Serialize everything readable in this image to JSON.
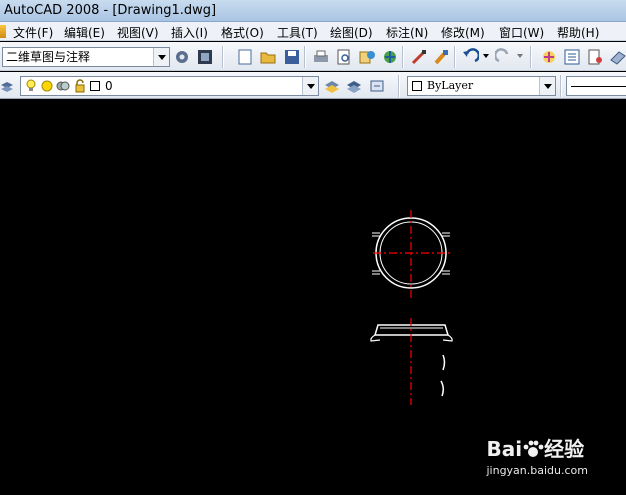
{
  "window": {
    "title": "AutoCAD 2008 - [Drawing1.dwg]"
  },
  "menu": {
    "items": [
      "文件(F)",
      "编辑(E)",
      "视图(V)",
      "插入(I)",
      "格式(O)",
      "工具(T)",
      "绘图(D)",
      "标注(N)",
      "修改(M)",
      "窗口(W)",
      "帮助(H)"
    ]
  },
  "toolbar": {
    "workspace_value": "二维草图与注释",
    "layer_value": "0",
    "color_value": "ByLayer"
  },
  "icons": {
    "app": "autocad-app-icon",
    "workspace_settings": "gear-icon",
    "my_workspace": "workspace-icon",
    "new": "new-file-icon",
    "open": "open-folder-icon",
    "save": "save-icon",
    "print": "print-icon",
    "preview": "print-preview-icon",
    "publish": "publish-icon",
    "3d_dwf": "3d-dwf-icon",
    "match": "match-properties-icon",
    "brush": "brush-icon",
    "undo": "undo-icon",
    "redo": "redo-icon",
    "pan": "pan-icon",
    "properties": "properties-icon",
    "design_center": "design-center-icon",
    "tool_palette": "tool-palette-icon",
    "layer_manager": "layer-manager-icon",
    "layer_state": "layer-state-icon",
    "layer_prev": "layer-previous-icon",
    "layer_bulb": "bulb-icon",
    "layer_sun": "sun-icon",
    "layer_lock": "lock-icon"
  },
  "colors": {
    "canvas_bg": "#000000",
    "line_white": "#ffffff",
    "centerline_red": "#ff0000"
  },
  "watermark": {
    "logo_text": "Bai",
    "logo_suffix": "经验",
    "url": "jingyan.baidu.com"
  }
}
